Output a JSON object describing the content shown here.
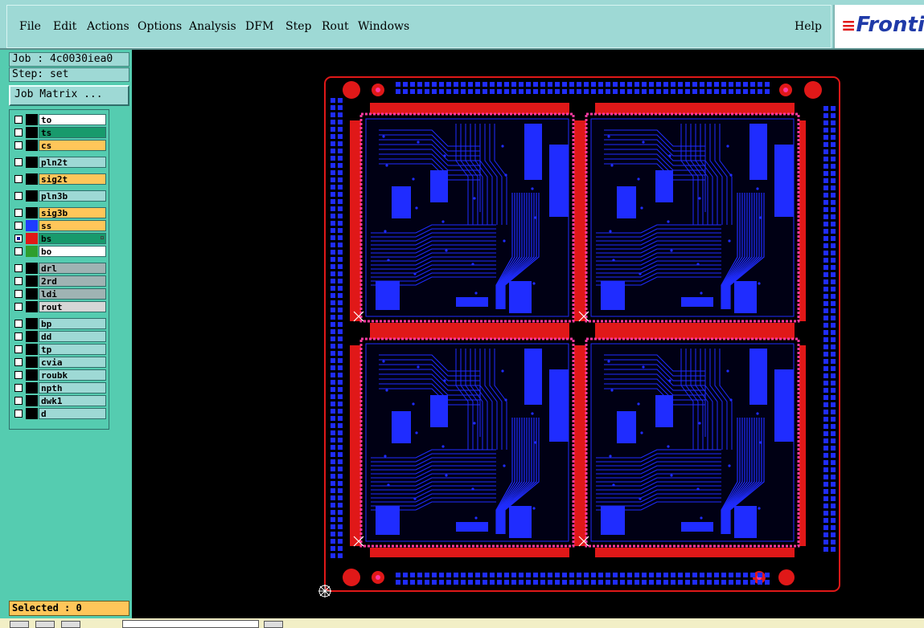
{
  "menu": {
    "items": [
      "File",
      "Edit",
      "Actions",
      "Options",
      "Analysis",
      "DFM",
      "Step",
      "Rout",
      "Windows"
    ],
    "help": "Help",
    "logo": "Fronti"
  },
  "job": {
    "label": "Job : 4c0030iea0",
    "step": "Step: set",
    "matrix_button": "Job Matrix ..."
  },
  "layers": [
    {
      "name": "to",
      "color": "#ffffff",
      "swatch": "#000000",
      "checked": false
    },
    {
      "name": "ts",
      "color": "#189a6c",
      "swatch": "#000000",
      "checked": false
    },
    {
      "name": "cs",
      "color": "#ffc65a",
      "swatch": "#000000",
      "checked": false
    },
    {
      "name": "pln2t",
      "color": "#9ed9d5",
      "swatch": "#000000",
      "checked": false
    },
    {
      "name": "sig2t",
      "color": "#ffc65a",
      "swatch": "#000000",
      "checked": false
    },
    {
      "name": "pln3b",
      "color": "#9ed9d5",
      "swatch": "#000000",
      "checked": false
    },
    {
      "name": "sig3b",
      "color": "#ffc65a",
      "swatch": "#000000",
      "checked": false
    },
    {
      "name": "ss",
      "color": "#ffc65a",
      "swatch": "#1e3cff",
      "checked": false
    },
    {
      "name": "bs",
      "color": "#189a6c",
      "swatch": "#e01818",
      "checked": true
    },
    {
      "name": "bo",
      "color": "#ffffff",
      "swatch": "#2e9e2e",
      "checked": false
    },
    {
      "name": "drl",
      "color": "#9fb3b3",
      "swatch": "#000000",
      "checked": false
    },
    {
      "name": "2rd",
      "color": "#9fb3b3",
      "swatch": "#000000",
      "checked": false
    },
    {
      "name": "ldi",
      "color": "#9fb3b3",
      "swatch": "#000000",
      "checked": false
    },
    {
      "name": "rout",
      "color": "#d6d6d6",
      "swatch": "#000000",
      "checked": false
    },
    {
      "name": "bp",
      "color": "#9ed9d5",
      "swatch": "#000000",
      "checked": false
    },
    {
      "name": "dd",
      "color": "#9ed9d5",
      "swatch": "#000000",
      "checked": false
    },
    {
      "name": "tp",
      "color": "#9ed9d5",
      "swatch": "#000000",
      "checked": false
    },
    {
      "name": "cvia",
      "color": "#9ed9d5",
      "swatch": "#000000",
      "checked": false
    },
    {
      "name": "roubk",
      "color": "#9ed9d5",
      "swatch": "#000000",
      "checked": false
    },
    {
      "name": "npth",
      "color": "#9ed9d5",
      "swatch": "#000000",
      "checked": false
    },
    {
      "name": "dwk1",
      "color": "#9ed9d5",
      "swatch": "#000000",
      "checked": false
    },
    {
      "name": "d",
      "color": "#9ed9d5",
      "swatch": "#000000",
      "checked": false
    }
  ],
  "status": {
    "selected": "Selected : 0"
  },
  "colors": {
    "copper_top": "#e01818",
    "copper_bottom": "#1f2cff",
    "pad_pink": "#ff3aa0",
    "background": "#000000"
  }
}
